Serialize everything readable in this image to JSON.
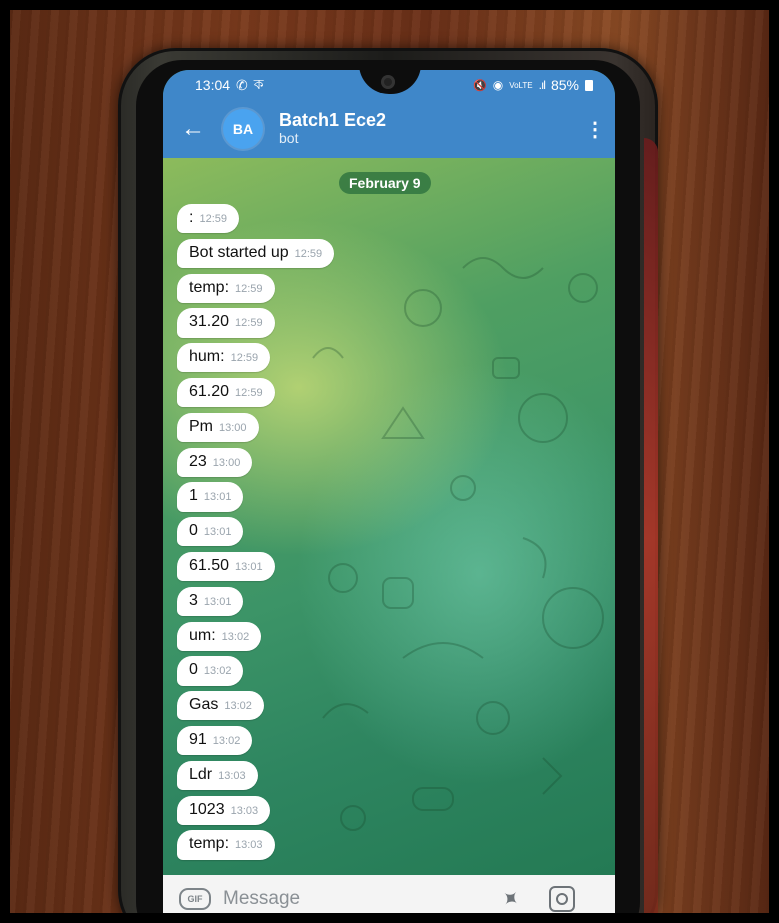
{
  "status_bar": {
    "time": "13:04",
    "left_icons": [
      "whatsapp-notification-icon",
      "app-notification-icon"
    ],
    "left_extra": "ক",
    "right_icons": [
      "mute-icon",
      "hotspot-icon",
      "volte-icon",
      "lte-icon",
      "signal-icon"
    ],
    "battery": "85%"
  },
  "header": {
    "avatar_initials": "BA",
    "chat_name": "Batch1 Ece2",
    "subtitle": "bot",
    "accent_color": "#3f87c9",
    "avatar_color": "#4aa3ef"
  },
  "chat": {
    "date_label": "February 9",
    "messages": [
      {
        "text": ":",
        "time": "12:59"
      },
      {
        "text": "Bot started up",
        "time": "12:59"
      },
      {
        "text": "temp:",
        "time": "12:59"
      },
      {
        "text": "31.20",
        "time": "12:59"
      },
      {
        "text": "hum:",
        "time": "12:59"
      },
      {
        "text": "61.20",
        "time": "12:59"
      },
      {
        "text": "Pm",
        "time": "13:00"
      },
      {
        "text": "23",
        "time": "13:00"
      },
      {
        "text": "1",
        "time": "13:01"
      },
      {
        "text": "0",
        "time": "13:01"
      },
      {
        "text": "61.50",
        "time": "13:01"
      },
      {
        "text": "3",
        "time": "13:01"
      },
      {
        "text": "um:",
        "time": "13:02"
      },
      {
        "text": "0",
        "time": "13:02"
      },
      {
        "text": "Gas",
        "time": "13:02"
      },
      {
        "text": "91",
        "time": "13:02"
      },
      {
        "text": "Ldr",
        "time": "13:03"
      },
      {
        "text": "1023",
        "time": "13:03"
      },
      {
        "text": "temp:",
        "time": "13:03"
      }
    ]
  },
  "composer": {
    "gif_label": "GIF",
    "placeholder": "Message"
  }
}
